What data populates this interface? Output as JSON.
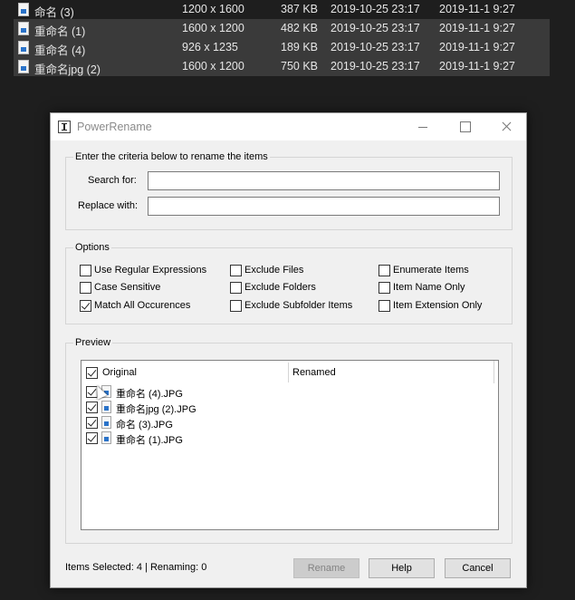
{
  "explorer": {
    "rows": [
      {
        "name": "命名 (3)",
        "dimensions": "1200 x 1600",
        "size": "387 KB",
        "created": "2019-10-25 23:17",
        "modified": "2019-11-1 9:27"
      },
      {
        "name": "重命名 (1)",
        "dimensions": "1600 x 1200",
        "size": "482 KB",
        "created": "2019-10-25 23:17",
        "modified": "2019-11-1 9:27"
      },
      {
        "name": "重命名 (4)",
        "dimensions": "926 x 1235",
        "size": "189 KB",
        "created": "2019-10-25 23:17",
        "modified": "2019-11-1 9:27"
      },
      {
        "name": "重命名jpg (2)",
        "dimensions": "1600 x 1200",
        "size": "750 KB",
        "created": "2019-10-25 23:17",
        "modified": "2019-11-1 9:27"
      }
    ]
  },
  "dialog": {
    "title": "PowerRename",
    "criteria": {
      "group_label": "Enter the criteria below to rename the items",
      "search_label": "Search for:",
      "search_value": "",
      "replace_label": "Replace with:",
      "replace_value": ""
    },
    "options": {
      "group_label": "Options",
      "use_regex": "Use Regular Expressions",
      "case_sensitive": "Case Sensitive",
      "match_all": "Match All Occurences",
      "exclude_files": "Exclude Files",
      "exclude_folders": "Exclude Folders",
      "exclude_subfolder": "Exclude Subfolder Items",
      "enumerate": "Enumerate Items",
      "name_only": "Item Name Only",
      "extension_only": "Item Extension Only"
    },
    "preview": {
      "group_label": "Preview",
      "col_original": "Original",
      "col_renamed": "Renamed",
      "items": [
        {
          "original": "重命名 (4).JPG"
        },
        {
          "original": "重命名jpg (2).JPG"
        },
        {
          "original": "命名 (3).JPG"
        },
        {
          "original": "重命名 (1).JPG"
        }
      ]
    },
    "status": "Items Selected: 4 | Renaming: 0",
    "buttons": {
      "rename": "Rename",
      "help": "Help",
      "cancel": "Cancel"
    }
  }
}
